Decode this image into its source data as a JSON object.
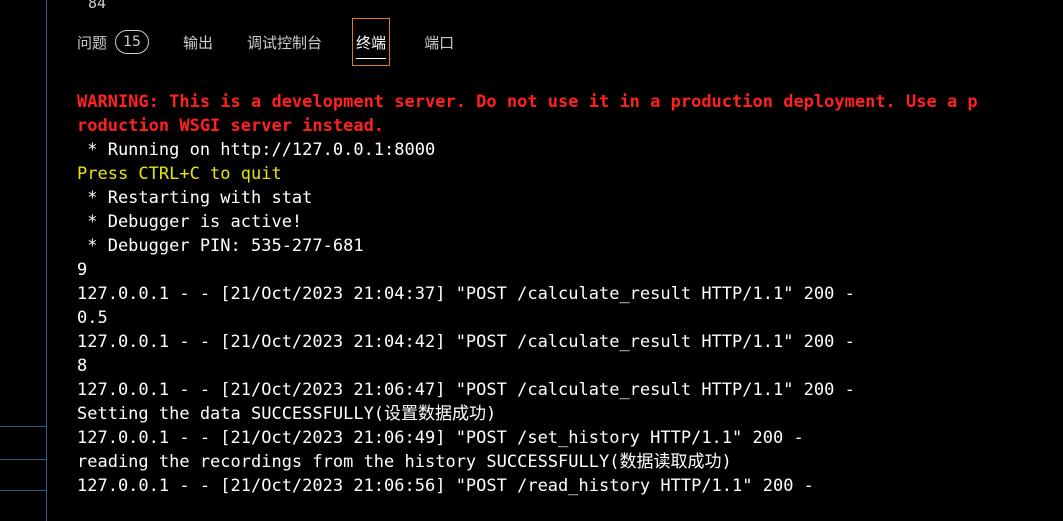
{
  "editor": {
    "line_number": "84"
  },
  "panel": {
    "tabs": [
      {
        "label": "问题",
        "badge": "15"
      },
      {
        "label": "输出"
      },
      {
        "label": "调试控制台"
      },
      {
        "label": "终端",
        "active": true
      },
      {
        "label": "端口"
      }
    ]
  },
  "colors": {
    "warning": "#ff2020",
    "hint": "#e5e510",
    "active_tab_border": "#e07a2b"
  },
  "terminal": {
    "lines": [
      {
        "text": "WARNING: This is a development server. Do not use it in a production deployment. Use a p",
        "style": "warn"
      },
      {
        "text": "roduction WSGI server instead.",
        "style": "warn"
      },
      {
        "text": " * Running on http://127.0.0.1:8000",
        "style": "normal"
      },
      {
        "text": "Press CTRL+C to quit",
        "style": "yellow"
      },
      {
        "text": " * Restarting with stat",
        "style": "normal"
      },
      {
        "text": " * Debugger is active!",
        "style": "normal"
      },
      {
        "text": " * Debugger PIN: 535-277-681",
        "style": "normal"
      },
      {
        "text": "9",
        "style": "normal"
      },
      {
        "text": "127.0.0.1 - - [21/Oct/2023 21:04:37] \"POST /calculate_result HTTP/1.1\" 200 -",
        "style": "normal"
      },
      {
        "text": "0.5",
        "style": "normal"
      },
      {
        "text": "127.0.0.1 - - [21/Oct/2023 21:04:42] \"POST /calculate_result HTTP/1.1\" 200 -",
        "style": "normal"
      },
      {
        "text": "8",
        "style": "normal"
      },
      {
        "text": "127.0.0.1 - - [21/Oct/2023 21:06:47] \"POST /calculate_result HTTP/1.1\" 200 -",
        "style": "normal"
      },
      {
        "text": "Setting the data SUCCESSFULLY(设置数据成功)",
        "style": "normal"
      },
      {
        "text": "127.0.0.1 - - [21/Oct/2023 21:06:49] \"POST /set_history HTTP/1.1\" 200 -",
        "style": "normal"
      },
      {
        "text": "reading the recordings from the history SUCCESSFULLY(数据读取成功)",
        "style": "normal"
      },
      {
        "text": "127.0.0.1 - - [21/Oct/2023 21:06:56] \"POST /read_history HTTP/1.1\" 200 -",
        "style": "normal"
      }
    ]
  }
}
